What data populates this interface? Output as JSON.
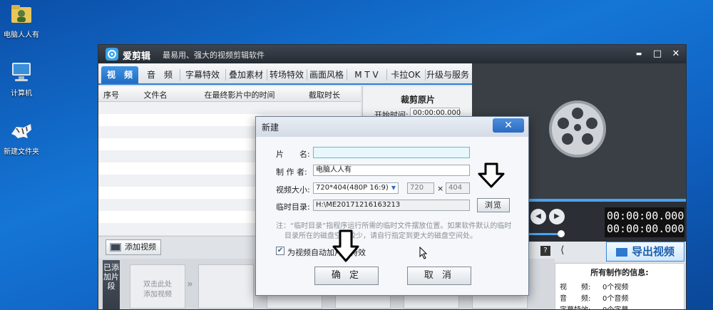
{
  "desktop": {
    "icons": [
      {
        "label": "电脑人人有",
        "icon": "folder-user-icon"
      },
      {
        "label": "计算机",
        "icon": "computer-icon"
      },
      {
        "label": "新建文件夹",
        "icon": "tiger-folder-icon"
      }
    ]
  },
  "window": {
    "app_name": "爱剪辑",
    "slogan": "最易用、强大的视频剪辑软件",
    "buttons": {
      "minimize": "▬",
      "maximize": "□",
      "close": "✕"
    }
  },
  "tabs": [
    {
      "label": "视　频",
      "active": true
    },
    {
      "label": "音　频",
      "active": false
    },
    {
      "label": "字幕特效",
      "active": false
    },
    {
      "label": "叠加素材",
      "active": false
    },
    {
      "label": "转场特效",
      "active": false
    },
    {
      "label": "画面风格",
      "active": false
    },
    {
      "label": "M T V",
      "active": false
    },
    {
      "label": "卡拉OK",
      "active": false
    },
    {
      "label": "升级与服务",
      "active": false
    }
  ],
  "table": {
    "columns": [
      "序号",
      "文件名",
      "在最终影片中的时间",
      "截取时长"
    ]
  },
  "crop_panel": {
    "title": "裁剪原片",
    "start_label": "开始时间:",
    "start_value": "00:00:00.000"
  },
  "player": {
    "timecode_current": "00:00:00.000",
    "timecode_total": "00:00:00.000"
  },
  "export_label": "导出视频",
  "info_panel": {
    "title": "所有制作的信息:",
    "rows": [
      {
        "label": "视　　频:",
        "value": "0个视频"
      },
      {
        "label": "音　　频:",
        "value": "0个音频"
      },
      {
        "label": "字幕特效:",
        "value": "0个字幕"
      }
    ]
  },
  "add_video_label": "添加视频",
  "strip": {
    "label": "已添加片段",
    "placeholder_line1": "双击此处",
    "placeholder_line2": "添加视频"
  },
  "dialog": {
    "title": "新建",
    "close": "✕",
    "name_label": "片　　名:",
    "name_value": "",
    "author_label": "制 作 者:",
    "author_value": "电脑人人有",
    "size_label": "视频大小:",
    "size_value": "720*404(480P 16:9)",
    "width_value": "720",
    "times": "×",
    "height_value": "404",
    "temp_label": "临时目录:",
    "temp_value": "H:\\ME20171216163213",
    "browse_label": "浏览",
    "note_line1": "注：“临时目录”指程序运行所需的临时文件摆放位置。如果软件默认的临时",
    "note_line2": "目录所在的磁盘空间较少，请自行指定到更大的磁盘空间处。",
    "checkbox_label": "为视频自动加片头特效",
    "checkbox_checked": true,
    "ok_label": "确 定",
    "cancel_label": "取 消"
  }
}
